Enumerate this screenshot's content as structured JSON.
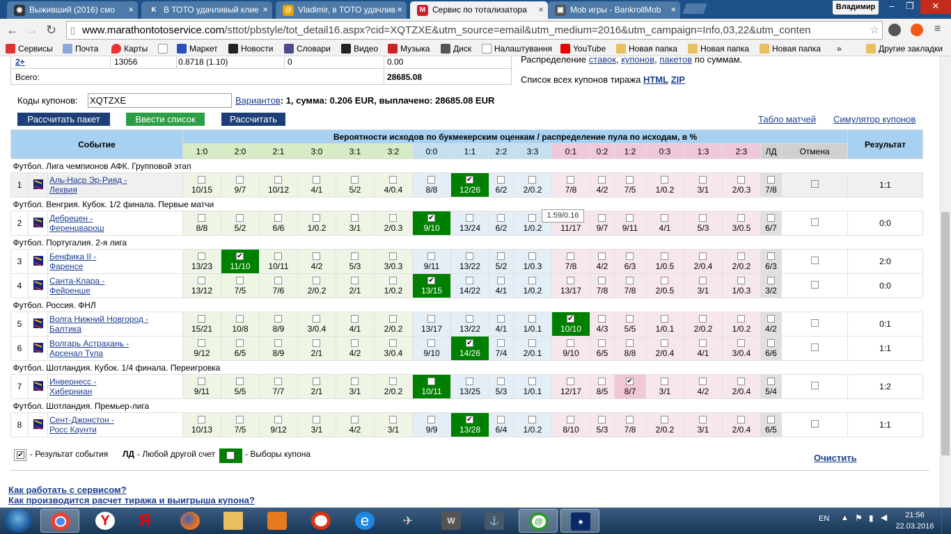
{
  "tabs": [
    {
      "title": "Выживший (2016) смо",
      "icon": "film-icon",
      "color": "#333"
    },
    {
      "title": "В ТОТО удачливый клие",
      "icon": "vk-icon",
      "color": "#4a76a8"
    },
    {
      "title": "Vladimir, в ТОТО удачлив",
      "icon": "mail-at-icon",
      "color": "#e6a400"
    },
    {
      "title": "Сервис по тотализатора",
      "icon": "m-icon",
      "color": "#cc1f2f"
    },
    {
      "title": "Mob игры - BankrollMob",
      "icon": "bankroll-icon",
      "color": "#555"
    }
  ],
  "profile_name": "Владимир",
  "url": {
    "host": "www.marathontotoservice.com",
    "rest": "/sttot/pbstyle/tot_detail16.aspx?cid=XQTZXE&utm_source=email&utm_medium=2016&utm_campaign=Info,03,22&utm_conten"
  },
  "bookmarks": [
    "Сервисы",
    "Почта",
    "Карты",
    "",
    "Маркет",
    "Новости",
    "Словари",
    "Видео",
    "Музыка",
    "Диск",
    "Налаштування",
    "YouTube",
    "Новая папка",
    "Новая папка",
    "Новая папка",
    "»",
    "Другие закладки"
  ],
  "top": {
    "row_label": "2+",
    "row_c1": "13056",
    "row_c2": "0.8718 (1.10)",
    "row_c3": "0",
    "row_c4": "0.00",
    "total_label": "Всего:",
    "total_value": "28685.08",
    "dist_prefix": "Распределение",
    "dist_links": [
      "ставок",
      "купонов",
      "пакетов"
    ],
    "dist_suffix": "по суммам.",
    "list_label": "Список всех купонов тиража",
    "list_html": "HTML",
    "list_zip": "ZIP",
    "codes_label": "Коды купонов:",
    "codes_value": "XQTZXE",
    "variants_link": "Вариантов",
    "variants_text": ": 1, сумма: 0.206 EUR, выплачено: 28685.08 EUR"
  },
  "buttons": {
    "calc_package": "Рассчитать пакет",
    "enter_list": "Ввести список",
    "calc": "Рассчитать"
  },
  "links": {
    "match_board": "Табло матчей",
    "coupon_sim": "Симулятор купонов",
    "clear": "Очистить",
    "how_work": "Как работать с сервисом?",
    "how_calc": "Как производится расчет тиража и выигрыша купона?"
  },
  "table": {
    "col_event": "Событие",
    "col_prob": "Вероятности исходов по букмекерским оценкам / распределение пула по исходам, в %",
    "col_result": "Результат",
    "outcomes": [
      "1:0",
      "2:0",
      "2:1",
      "3:0",
      "3:1",
      "3:2",
      "0:0",
      "1:1",
      "2:2",
      "3:3",
      "0:1",
      "0:2",
      "1:2",
      "0:3",
      "1:3",
      "2:3",
      "ЛД",
      "Отмена"
    ],
    "outcome_groups": [
      "g",
      "g",
      "g",
      "g",
      "g",
      "g",
      "b",
      "b",
      "b",
      "b",
      "p",
      "p",
      "p",
      "p",
      "p",
      "p",
      "ld",
      "ld"
    ],
    "sections": [
      {
        "title": "Футбол. Лига чемпионов АФК. Групповой этап",
        "events": [
          {
            "num": "1",
            "team1": "Аль-Наср Эр-Рияд -",
            "team2": "Лехвия",
            "vals": [
              "10/15",
              "9/7",
              "10/12",
              "4/1",
              "5/2",
              "4/0.4",
              "8/8",
              "12/26",
              "6/2",
              "2/0.2",
              "7/8",
              "4/2",
              "7/5",
              "1/0.2",
              "3/1",
              "2/0.3",
              "7/8"
            ],
            "checked": 7,
            "selected": 7,
            "result": "1:1",
            "alt": true
          }
        ]
      },
      {
        "title": "Футбол. Венгрия. Кубок. 1/2 финала. Первые матчи",
        "events": [
          {
            "num": "2",
            "team1": "Дебрецен -",
            "team2": "Ференцварош",
            "vals": [
              "8/8",
              "5/2",
              "6/6",
              "1/0.2",
              "3/1",
              "2/0.3",
              "9/10",
              "13/24",
              "6/2",
              "1/0.2",
              "11/17",
              "9/7",
              "9/11",
              "4/1",
              "5/3",
              "3/0.5",
              "6/7"
            ],
            "checked": 6,
            "selected": 6,
            "result": "0:0"
          }
        ]
      },
      {
        "title": "Футбол. Португалия. 2-я лига",
        "events": [
          {
            "num": "3",
            "team1": "Бенфика II -",
            "team2": "Фаренсе",
            "vals": [
              "13/23",
              "11/10",
              "10/11",
              "4/2",
              "5/3",
              "3/0.3",
              "9/11",
              "13/22",
              "5/2",
              "1/0.3",
              "7/8",
              "4/2",
              "6/3",
              "1/0.5",
              "2/0.4",
              "2/0.2",
              "6/3"
            ],
            "checked": 1,
            "selected": 1,
            "result": "2:0"
          },
          {
            "num": "4",
            "team1": "Санта-Клара -",
            "team2": "Фейренше",
            "vals": [
              "13/12",
              "7/5",
              "7/6",
              "2/0.2",
              "2/1",
              "1/0.2",
              "13/15",
              "14/22",
              "4/1",
              "1/0.2",
              "13/17",
              "7/8",
              "7/8",
              "2/0.5",
              "3/1",
              "1/0.3",
              "3/2"
            ],
            "checked": 6,
            "selected": 6,
            "result": "0:0"
          }
        ]
      },
      {
        "title": "Футбол. Россия. ФНЛ",
        "events": [
          {
            "num": "5",
            "team1": "Волга Нижний Новгород -",
            "team2": "Балтика",
            "vals": [
              "15/21",
              "10/8",
              "8/9",
              "3/0.4",
              "4/1",
              "2/0.2",
              "13/17",
              "13/22",
              "4/1",
              "1/0.1",
              "10/10",
              "4/3",
              "5/5",
              "1/0.1",
              "2/0.2",
              "1/0.2",
              "4/2"
            ],
            "checked": 10,
            "selected": 10,
            "result": "0:1"
          },
          {
            "num": "6",
            "team1": "Волгарь Астрахань -",
            "team2": "Арсенал Тула",
            "vals": [
              "9/12",
              "6/5",
              "8/9",
              "2/1",
              "4/2",
              "3/0.4",
              "9/10",
              "14/26",
              "7/4",
              "2/0.1",
              "9/10",
              "6/5",
              "8/8",
              "2/0.4",
              "4/1",
              "3/0.4",
              "6/6"
            ],
            "checked": 7,
            "selected": 7,
            "result": "1:1"
          }
        ]
      },
      {
        "title": "Футбол. Шотландия. Кубок. 1/4 финала. Переигровка",
        "events": [
          {
            "num": "7",
            "team1": "Инвернесс -",
            "team2": "Хиберниан",
            "vals": [
              "9/11",
              "5/5",
              "7/7",
              "2/1",
              "3/1",
              "2/0.2",
              "10/11",
              "13/25",
              "5/3",
              "1/0.1",
              "12/17",
              "8/5",
              "8/7",
              "3/1",
              "4/2",
              "2/0.4",
              "5/4"
            ],
            "checked": 12,
            "selected": 6,
            "pink": 12,
            "result": "1:2"
          }
        ]
      },
      {
        "title": "Футбол. Шотландия. Премьер-лига",
        "events": [
          {
            "num": "8",
            "team1": "Сент-Джонстон -",
            "team2": "Росс Каунти",
            "vals": [
              "10/13",
              "7/5",
              "9/12",
              "3/1",
              "4/2",
              "3/1",
              "9/9",
              "13/28",
              "6/4",
              "1/0.2",
              "8/10",
              "5/3",
              "7/8",
              "2/0.2",
              "3/1",
              "2/0.4",
              "6/5"
            ],
            "checked": 7,
            "selected": 7,
            "result": "1:1"
          }
        ]
      }
    ]
  },
  "tooltip": "1.59/0.16",
  "legend": {
    "result_event": "- Результат события",
    "ld_abbr": "ЛД",
    "ld_text": "- Любой другой счет",
    "coupon_choice": "- Выборы купона"
  },
  "taskbar": {
    "lang": "EN",
    "time": "21:56",
    "date": "22.03.2016"
  }
}
